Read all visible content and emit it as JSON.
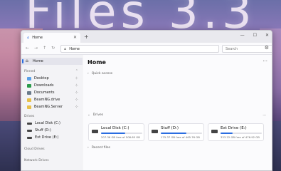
{
  "hero": {
    "title": "Files 3.3"
  },
  "window": {
    "tab": {
      "label": "Home"
    },
    "newtab": "+",
    "controls": [
      "—",
      "☐",
      "✕"
    ]
  },
  "nav": {
    "address": "Home",
    "search_placeholder": "Search"
  },
  "sidebar": {
    "home_label": "Home",
    "pinned_header": "Pinned",
    "pinned": [
      "Desktop",
      "Downloads",
      "Documents",
      "BeamNG.drive",
      "BeamNG.Server"
    ],
    "drives_header": "Drives",
    "drives": [
      "Local Disk (C:)",
      "Stuff (D:)",
      "Ext Drive (E:)"
    ],
    "cloud_header": "Cloud Drives",
    "network_header": "Network Drives"
  },
  "main": {
    "title": "Home",
    "quick_access": "Quick access",
    "drives_label": "Drives",
    "recent_label": "Recent files",
    "drive_cards": [
      {
        "name": "Local Disk (C:)",
        "free": "207.36 GB free of 508.65 GB",
        "used_fraction": 0.59
      },
      {
        "name": "Stuff (D:)",
        "free": "175.37 GB free of 465.76 GB",
        "used_fraction": 0.62
      },
      {
        "name": "Ext Drive (E:)",
        "free": "333.22 GB free of 476.92 GB",
        "used_fraction": 0.3
      }
    ]
  },
  "colors": {
    "accent": "#2a6de0"
  }
}
